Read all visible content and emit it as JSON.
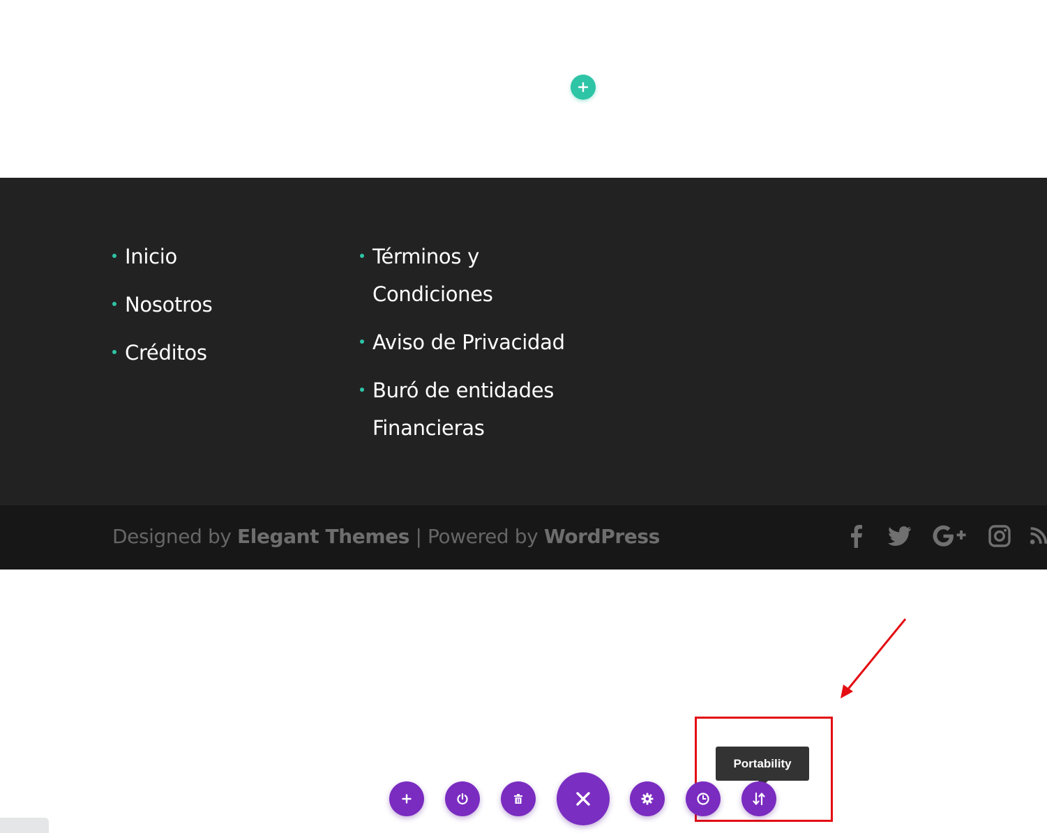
{
  "page": {
    "add_section_icon": "plus-icon",
    "accent_color": "#2ec4a6",
    "builder_color": "#7a2bc0"
  },
  "footer": {
    "column_1": [
      {
        "label": "Inicio"
      },
      {
        "label": "Nosotros"
      },
      {
        "label": "Créditos"
      }
    ],
    "column_2": [
      {
        "label": "Términos y Condiciones"
      },
      {
        "label": "Aviso de Privacidad"
      },
      {
        "label": "Buró de entidades Financieras"
      }
    ],
    "credits": {
      "designed_by": "Designed by ",
      "elegant_themes": "Elegant Themes",
      "separator": " | Powered by ",
      "wordpress": "WordPress"
    },
    "social_icons": [
      "facebook-icon",
      "twitter-icon",
      "google-plus-icon",
      "instagram-icon",
      "rss-icon"
    ]
  },
  "builder_bar": {
    "buttons": [
      {
        "name": "add-button",
        "icon": "plus-icon"
      },
      {
        "name": "power-button",
        "icon": "power-icon"
      },
      {
        "name": "trash-button",
        "icon": "trash-icon"
      },
      {
        "name": "close-button",
        "icon": "close-icon"
      },
      {
        "name": "settings-button",
        "icon": "gear-icon"
      },
      {
        "name": "history-button",
        "icon": "clock-icon"
      },
      {
        "name": "portability-button",
        "icon": "portability-icon"
      }
    ],
    "tooltip": "Portability"
  },
  "annotation": {
    "color": "#e30d12"
  }
}
